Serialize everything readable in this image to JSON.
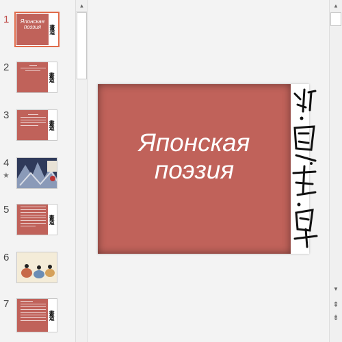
{
  "slides_pane": {
    "items": [
      {
        "number": "1",
        "title": "Японская поэзия",
        "active": true
      },
      {
        "number": "2"
      },
      {
        "number": "3"
      },
      {
        "number": "4",
        "star": "★"
      },
      {
        "number": "5"
      },
      {
        "number": "6"
      },
      {
        "number": "7"
      }
    ]
  },
  "slide": {
    "title": "Японская поэзия"
  },
  "scroll": {
    "up_icon": "▲",
    "down_icon": "▼",
    "prev_slide_icon": "⇞",
    "next_slide_icon": "⇟"
  },
  "colors": {
    "slide_red": "#c0625a",
    "active_border": "#e06b4a"
  }
}
